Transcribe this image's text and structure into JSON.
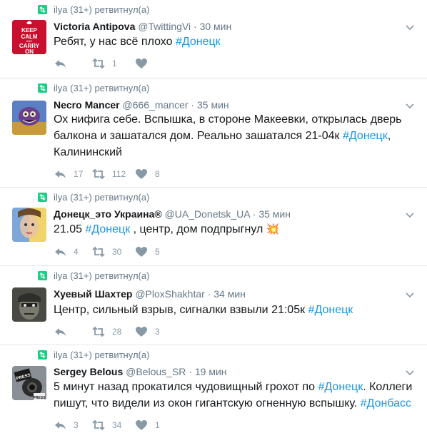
{
  "retweeter_line": "ilya (31+) ретвитнул(а)",
  "tweets": [
    {
      "name": "Victoria Antipova",
      "handle": "@TwittingVi",
      "time": "30 мин",
      "text_parts": [
        "Ребят, у нас всё плохо ",
        "#Донецк"
      ],
      "replies": "",
      "retweets": "1",
      "likes": "",
      "avatar": "keep-calm"
    },
    {
      "name": "Necro Mancer",
      "handle": "@666_mancer",
      "time": "35 мин",
      "text_parts": [
        "Ох нифига себе. Вспышка, в стороне Макеевки, открылась дверь балкона и зашатался дом. Реально зашатался 21-04к ",
        "#Донецк",
        ", Калининский"
      ],
      "replies": "17",
      "retweets": "112",
      "likes": "8",
      "avatar": "monster"
    },
    {
      "name": "Донецк_это Украина®",
      "handle": "@UA_Donetsk_UA",
      "time": "35 мин",
      "text_parts": [
        "21.05 ",
        "#Донецк",
        " , центр, дом подпрыгнул ",
        "💥"
      ],
      "replies": "4",
      "retweets": "30",
      "likes": "5",
      "avatar": "face"
    },
    {
      "name": "Хуевый Шахтер",
      "handle": "@PloxShakhtar",
      "time": "34 мин",
      "text_parts": [
        "Центр, сильный взрыв, сигналки взвыли 21:05к ",
        "#Донецк"
      ],
      "replies": "",
      "retweets": "28",
      "likes": "3",
      "avatar": "miner"
    },
    {
      "name": "Sergey Belous",
      "handle": "@Belous_SR",
      "time": "19 мин",
      "text_parts": [
        "5 минут назад прокатился чудовищный грохот по ",
        "#Донецк",
        ". Коллеги пишут, что видели из окон гигантскую огненную вспышку. ",
        "#Донбасс"
      ],
      "replies": "3",
      "retweets": "34",
      "likes": "1",
      "avatar": "press"
    }
  ],
  "colors": {
    "retweet_green": "#19cf86",
    "hashtag_blue": "#1b95e0",
    "muted": "#657786",
    "icon_gray": "#8899a6"
  },
  "icons": {
    "retweeted": "retweet-icon",
    "reply": "reply-icon",
    "retweet": "retweet-icon",
    "like": "heart-icon",
    "menu": "chevron-down-icon"
  }
}
